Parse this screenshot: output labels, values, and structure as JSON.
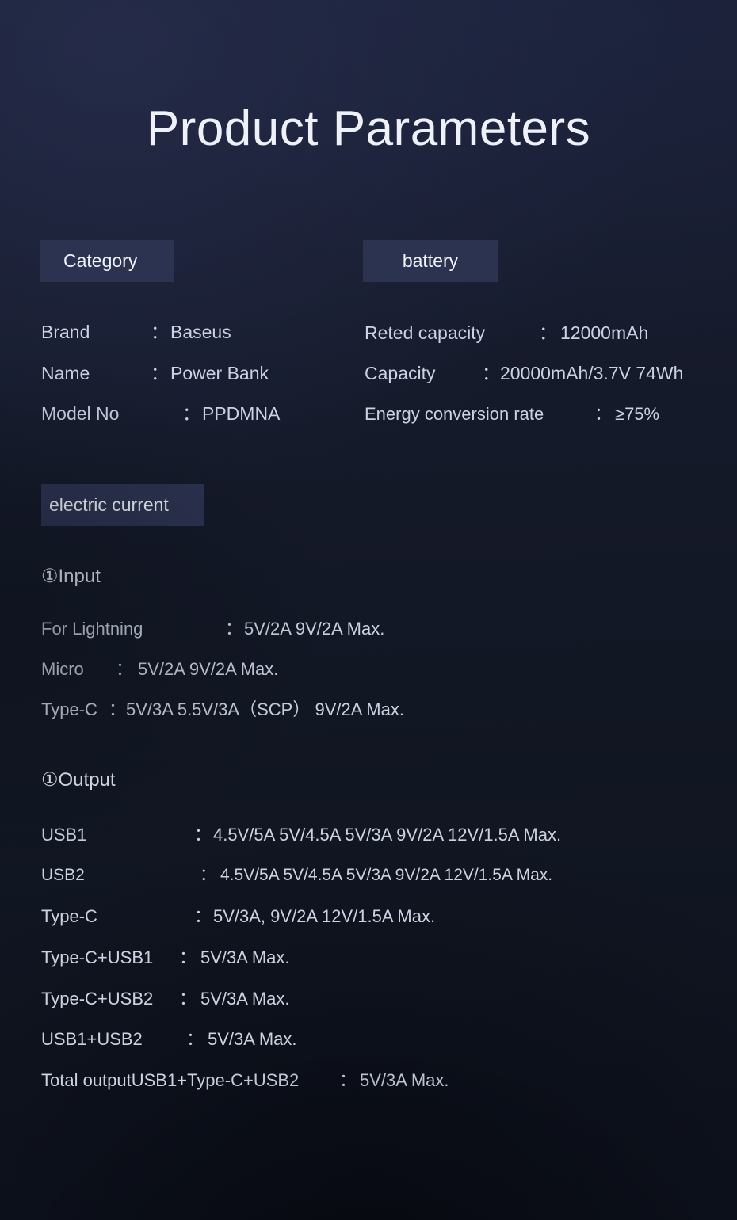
{
  "page": {
    "title": "Product Parameters",
    "background_top": "#181c2e",
    "background_bottom": "#0f131e",
    "badge_color": "#2c3350",
    "text_color": "#ccd2e1"
  },
  "sections": {
    "category": {
      "badge": "Category",
      "rows": [
        {
          "label": "Brand",
          "colon": "：",
          "value": "Baseus"
        },
        {
          "label": "Name",
          "colon": "：",
          "value": "Power Bank"
        },
        {
          "label": "Model No",
          "colon": "：",
          "value": "PPDMNA"
        }
      ]
    },
    "battery": {
      "badge": "battery",
      "rows": [
        {
          "label": "Reted capacity",
          "colon": "：",
          "value": "12000mAh"
        },
        {
          "label": "Capacity",
          "colon": "：",
          "value": "20000mAh/3.7V 74Wh"
        },
        {
          "label": "Energy conversion rate",
          "colon": "：",
          "value": "≥75%"
        }
      ]
    },
    "electric_current": {
      "badge": "electric current",
      "input": {
        "heading": "①Input",
        "rows": [
          {
            "label": "For Lightning",
            "colon": "：",
            "value": "5V/2A  9V/2A  Max."
          },
          {
            "label": "Micro",
            "colon": "：",
            "value": "5V/2A   9V/2A  Max."
          },
          {
            "label": "Type-C",
            "colon": "：",
            "value": "5V/3A 5.5V/3A（SCP） 9V/2A Max."
          }
        ]
      },
      "output": {
        "heading": "①Output",
        "rows": [
          {
            "label": "USB1",
            "colon": "：",
            "value": "4.5V/5A 5V/4.5A  5V/3A 9V/2A 12V/1.5A Max."
          },
          {
            "label": "USB2",
            "colon": "：",
            "value": "4.5V/5A 5V/4.5A  5V/3A 9V/2A 12V/1.5A Max."
          },
          {
            "label": "Type-C",
            "colon": "：",
            "value": "5V/3A, 9V/2A  12V/1.5A Max."
          },
          {
            "label": "Type-C+USB1",
            "colon": "：",
            "value": "5V/3A Max."
          },
          {
            "label": "Type-C+USB2",
            "colon": "：",
            "value": "5V/3A Max."
          },
          {
            "label": "USB1+USB2",
            "colon": "：",
            "value": "5V/3A Max."
          },
          {
            "label": "Total outputUSB1+Type-C+USB2",
            "colon": "：",
            "value": "5V/3A Max."
          }
        ]
      }
    }
  }
}
